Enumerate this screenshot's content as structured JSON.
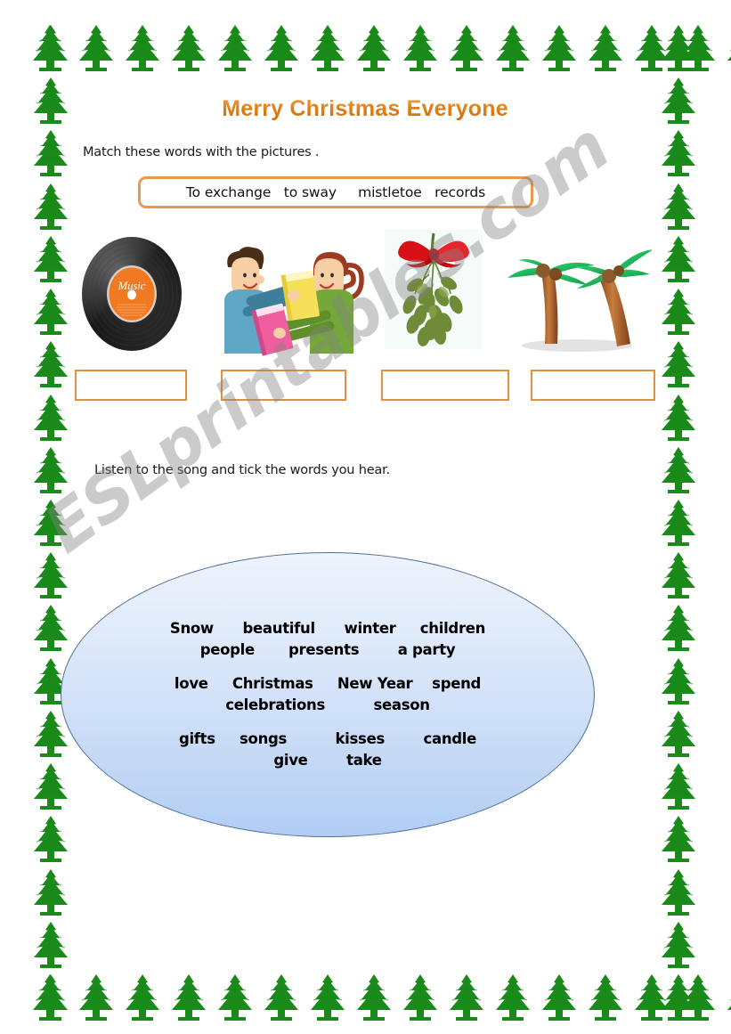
{
  "page": {
    "title": "Merry Christmas Everyone",
    "title_color": "#dd7711",
    "background": "#ffffff",
    "watermark": "ESLprintables.com"
  },
  "border": {
    "icon": "christmas-tree-icon",
    "color": "#1a8a1a",
    "top_count": 16,
    "bottom_count": 16,
    "side_count": 19
  },
  "exercise1": {
    "instruction": "Match these words with the pictures .",
    "wordbank": {
      "words": [
        "To exchange",
        "to sway",
        "mistletoe",
        "records"
      ],
      "display": "To exchange   to sway     mistletoe   records",
      "border_color": "#e79a4e"
    },
    "pictures": [
      {
        "name": "vinyl-record-image",
        "alt": "vinyl record",
        "label": "Music"
      },
      {
        "name": "people-exchanging-books-image",
        "alt": "two people exchanging books"
      },
      {
        "name": "mistletoe-image",
        "alt": "mistletoe with red bow"
      },
      {
        "name": "swaying-palm-trees-image",
        "alt": "palm trees swaying"
      }
    ],
    "answers": [
      "",
      "",
      "",
      ""
    ],
    "answer_box_border_color": "#e58f3e"
  },
  "exercise2": {
    "instruction": "Listen to the song and tick the words you hear.",
    "oval": {
      "border_color": "#4f7096",
      "fill_top": "#eef3fc",
      "fill_bottom": "#b2cdf3"
    },
    "word_groups": [
      {
        "lines": [
          "Snow      beautiful      winter     children",
          "people       presents        a party"
        ]
      },
      {
        "lines": [
          "love     Christmas     New Year    spend",
          "celebrations          season"
        ]
      },
      {
        "lines": [
          "gifts     songs          kisses        candle",
          "give        take"
        ]
      }
    ],
    "words": [
      "Snow",
      "beautiful",
      "winter",
      "children",
      "people",
      "presents",
      "a party",
      "love",
      "Christmas",
      "New Year",
      "spend",
      "celebrations",
      "season",
      "gifts",
      "songs",
      "kisses",
      "candle",
      "give",
      "take"
    ]
  }
}
